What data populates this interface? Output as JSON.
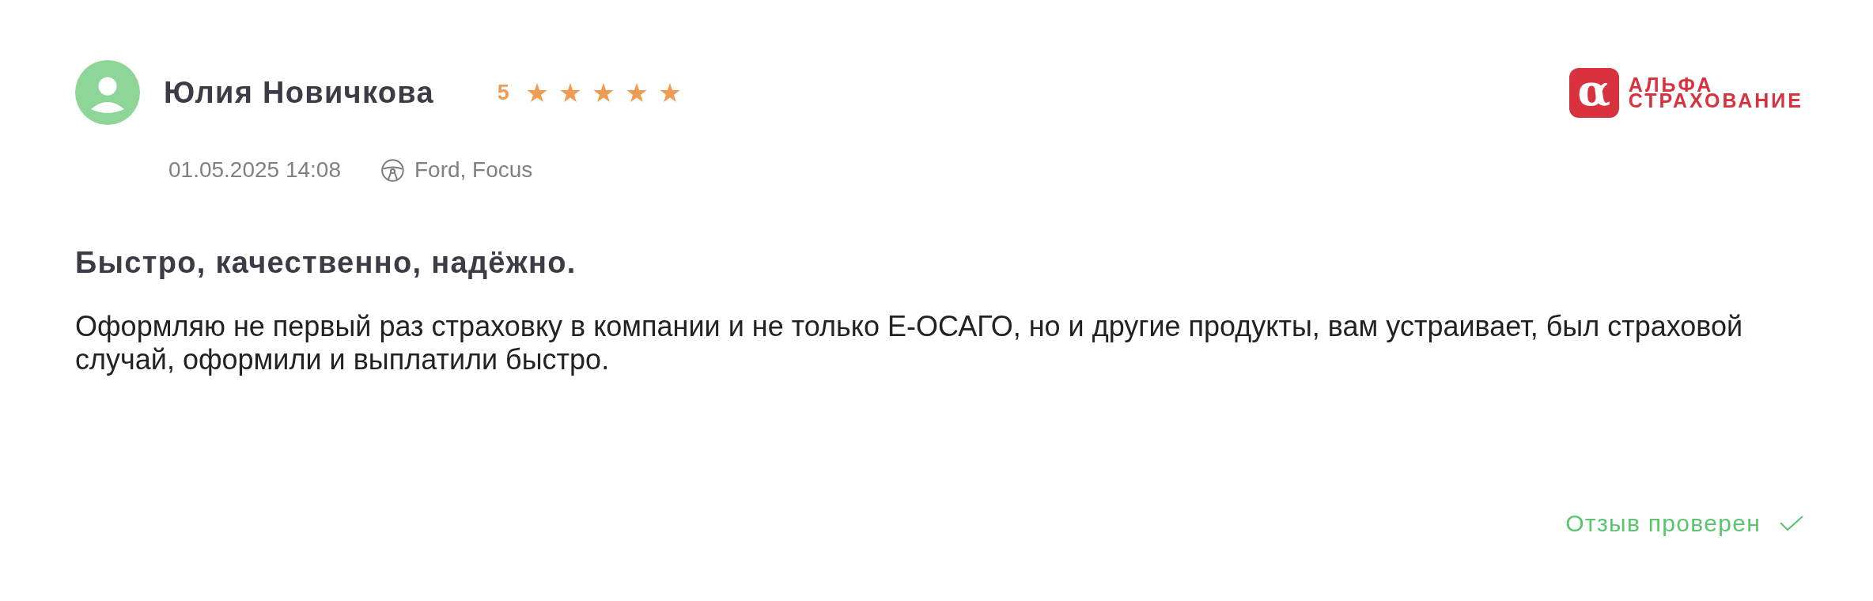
{
  "review": {
    "author": {
      "name": "Юлия Новичкова"
    },
    "rating": {
      "value": "5",
      "stars": 5
    },
    "date": "01.05.2025 14:08",
    "car": "Ford, Focus",
    "title": "Быстро, качественно, надёжно.",
    "text": "Оформляю не первый раз страховку в компании и не только Е-ОСАГО, но и другие продукты, вам устраивает, был страховой случай, оформили и выплатили быстро.",
    "verified": {
      "label": "Отзыв проверен",
      "checked": true
    }
  },
  "insurer_logo": {
    "mark": "α",
    "lines": [
      "АЛЬФА",
      "СТРАХОВАНИЕ"
    ]
  }
}
